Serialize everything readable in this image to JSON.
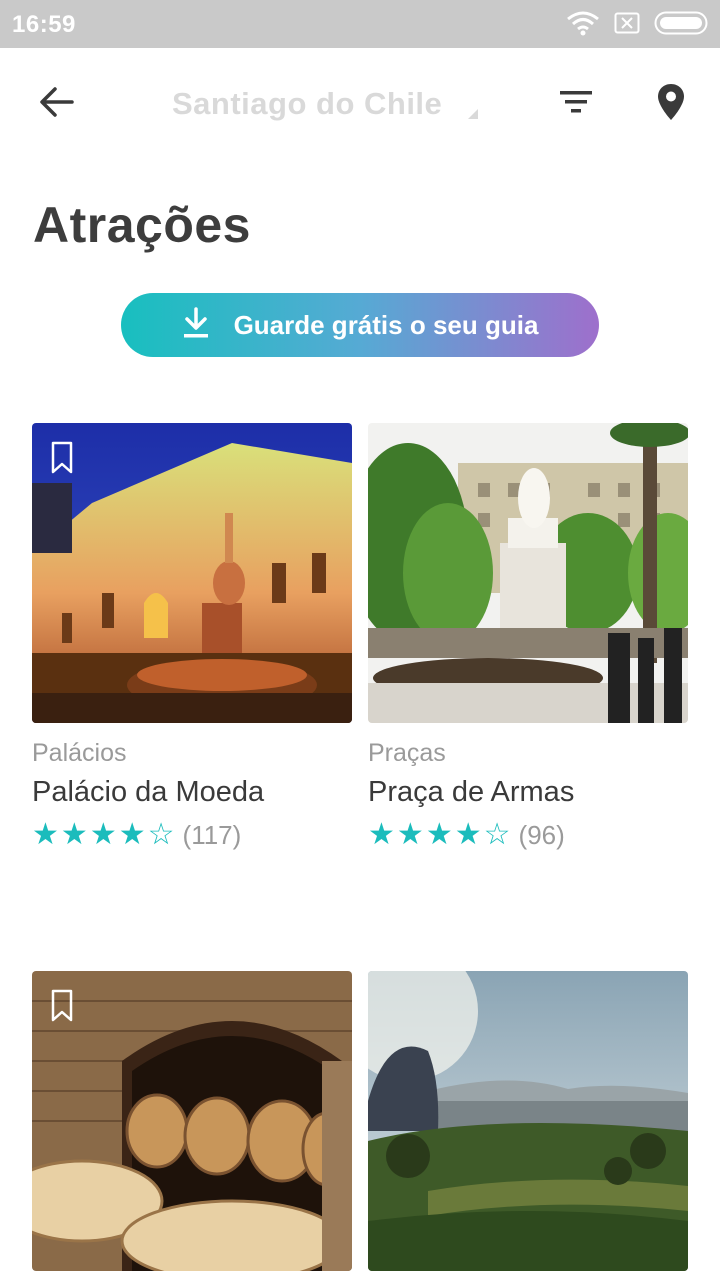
{
  "status_bar": {
    "time": "16:59",
    "icons": [
      "wifi-icon",
      "sim-card-icon",
      "battery-icon"
    ]
  },
  "header": {
    "back_icon": "arrow-left-icon",
    "city": "Santiago do Chile",
    "filter_icon": "filter-icon",
    "map_icon": "map-pin-icon"
  },
  "page": {
    "title": "Atrações"
  },
  "download": {
    "icon": "download-icon",
    "label": "Guarde grátis o seu guia"
  },
  "colors": {
    "accent": "#1bbcbc",
    "gradient_start": "#18bfbf",
    "gradient_end": "#9e6fcc"
  },
  "attractions": [
    {
      "category": "Palácios",
      "name": "Palácio da Moeda",
      "rating": 4,
      "max_rating": 5,
      "reviews": "(117)",
      "bookmark_icon": "bookmark-icon",
      "image": "palace-photo"
    },
    {
      "category": "Praças",
      "name": "Praça de Armas",
      "rating": 4,
      "max_rating": 5,
      "reviews": "(96)",
      "image": "plaza-photo"
    },
    {
      "category": "",
      "name": "",
      "bookmark_icon": "bookmark-icon",
      "image": "wine-cellar-photo"
    },
    {
      "category": "",
      "name": "",
      "image": "hill-view-photo"
    }
  ]
}
